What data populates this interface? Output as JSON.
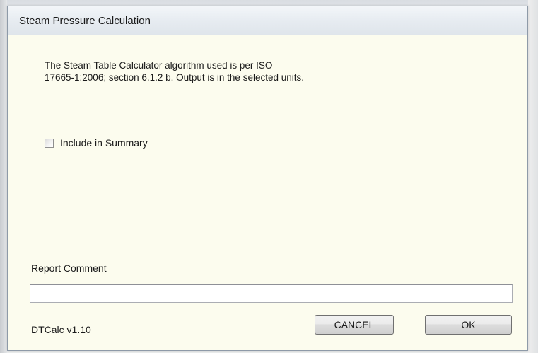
{
  "window": {
    "title": "Steam Pressure Calculation"
  },
  "description": {
    "line1": "The Steam Table Calculator algorithm used is per ISO",
    "line2": "17665-1:2006; section 6.1.2 b.   Output is in the selected units."
  },
  "summary_checkbox": {
    "label": "Include in Summary",
    "checked": false
  },
  "report_comment": {
    "label": "Report Comment",
    "value": ""
  },
  "footer": {
    "version": "DTCalc v1.10",
    "cancel_label": "CANCEL",
    "ok_label": "OK"
  },
  "colors": {
    "window_background": "#fcfcee",
    "titlebar_background": "#e7ecf1",
    "button_border": "#707070"
  }
}
